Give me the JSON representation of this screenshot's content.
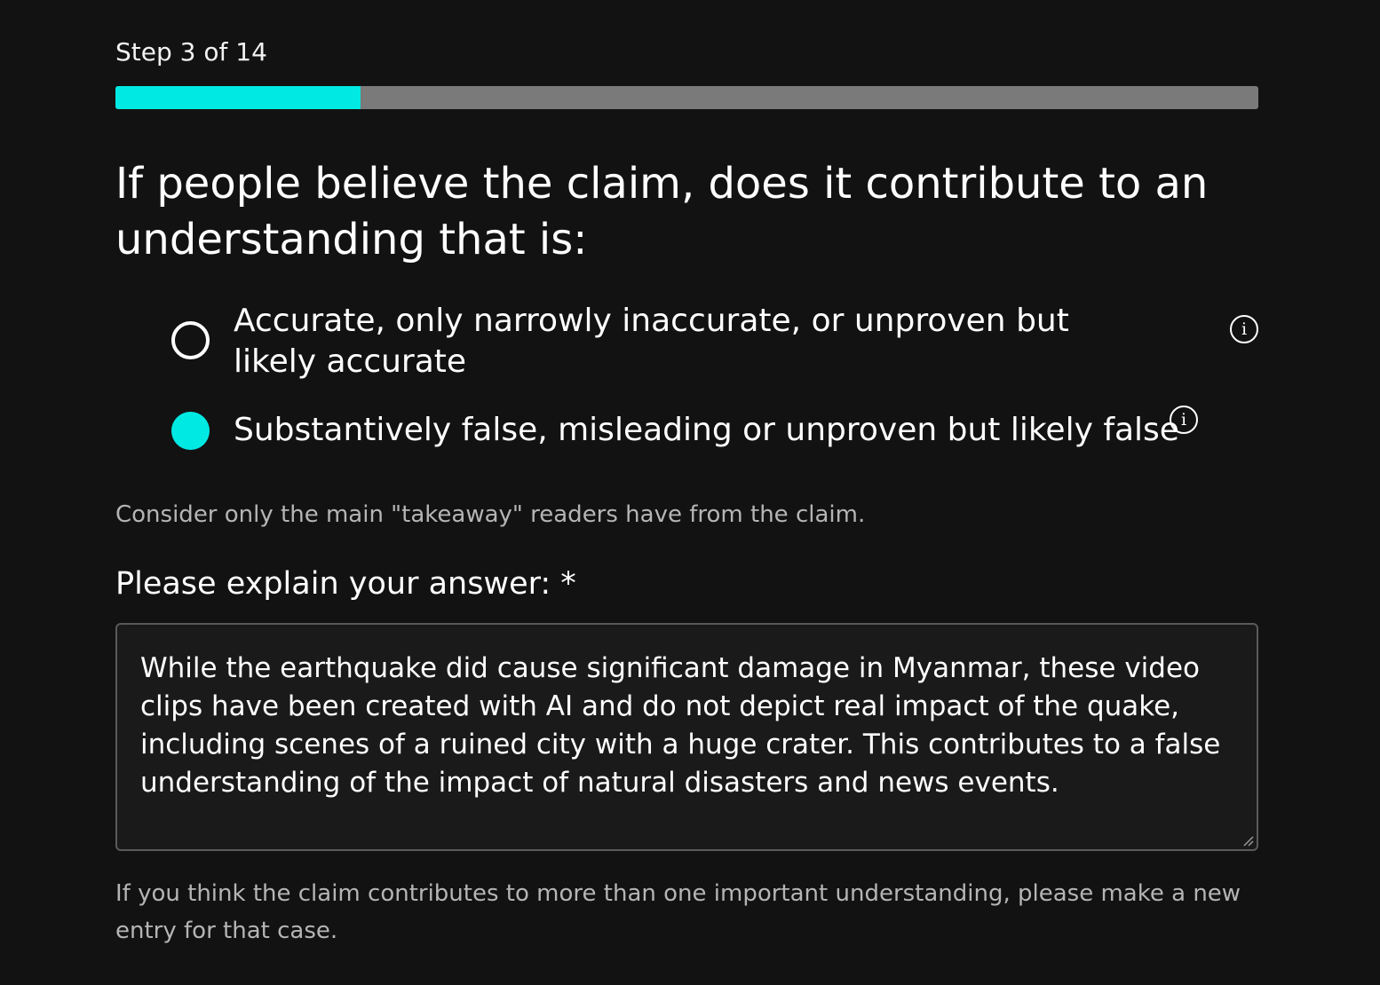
{
  "step": {
    "text": "Step 3 of 14",
    "current": 3,
    "total": 14,
    "progress_fraction": 0.2143
  },
  "colors": {
    "background": "#121212",
    "accent": "#00e9e3",
    "track": "#7a7a7a",
    "hint_text": "#b5b5b5"
  },
  "question": "If people believe the claim, does it contribute to an understanding that is:",
  "options": [
    {
      "label": "Accurate, only narrowly inaccurate, or unproven but likely accurate",
      "selected": false,
      "info_icon": "info-icon"
    },
    {
      "label": "Substantively false, misleading or unproven but likely false",
      "selected": true,
      "info_icon": "info-icon"
    }
  ],
  "hint_takeaway": "Consider only the main \"takeaway\" readers have from the claim.",
  "explain": {
    "label": "Please explain your answer: *",
    "value": "While the earthquake did cause significant damage in Myanmar, these video clips have been created with AI and do not depict real impact of the quake, including scenes of a ruined city with a huge crater. This contributes to a false understanding of the impact of natural disasters and news events."
  },
  "hint_multiple": "If you think the claim contributes to more than one important understanding, please make a new entry for that case.",
  "icons": {
    "info": "i",
    "resize": "resize-grip-icon"
  }
}
